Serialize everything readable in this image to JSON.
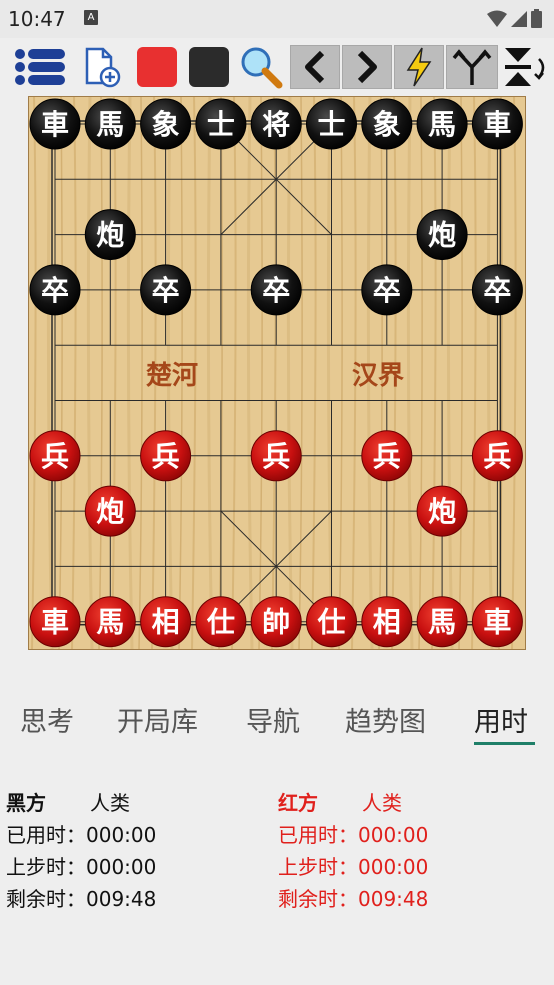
{
  "status_bar": {
    "time": "10:47",
    "indicator": "A"
  },
  "toolbar": {
    "buttons": [
      {
        "name": "menu-icon"
      },
      {
        "name": "new-game-icon"
      },
      {
        "name": "red-swatch-icon",
        "color": "#e83030"
      },
      {
        "name": "black-swatch-icon",
        "color": "#2b2b2b"
      },
      {
        "name": "search-icon"
      },
      {
        "name": "back-icon"
      },
      {
        "name": "forward-icon"
      },
      {
        "name": "lightning-icon"
      },
      {
        "name": "branch-icon"
      },
      {
        "name": "flip-icon"
      }
    ]
  },
  "board": {
    "river_left": "楚河",
    "river_right": "汉界",
    "black_pieces": [
      {
        "ch": "車",
        "file": 0,
        "rank": 0
      },
      {
        "ch": "馬",
        "file": 1,
        "rank": 0
      },
      {
        "ch": "象",
        "file": 2,
        "rank": 0
      },
      {
        "ch": "士",
        "file": 3,
        "rank": 0
      },
      {
        "ch": "将",
        "file": 4,
        "rank": 0
      },
      {
        "ch": "士",
        "file": 5,
        "rank": 0
      },
      {
        "ch": "象",
        "file": 6,
        "rank": 0
      },
      {
        "ch": "馬",
        "file": 7,
        "rank": 0
      },
      {
        "ch": "車",
        "file": 8,
        "rank": 0
      },
      {
        "ch": "炮",
        "file": 1,
        "rank": 2
      },
      {
        "ch": "炮",
        "file": 7,
        "rank": 2
      },
      {
        "ch": "卒",
        "file": 0,
        "rank": 3
      },
      {
        "ch": "卒",
        "file": 2,
        "rank": 3
      },
      {
        "ch": "卒",
        "file": 4,
        "rank": 3
      },
      {
        "ch": "卒",
        "file": 6,
        "rank": 3
      },
      {
        "ch": "卒",
        "file": 8,
        "rank": 3
      }
    ],
    "red_pieces": [
      {
        "ch": "兵",
        "file": 0,
        "rank": 6
      },
      {
        "ch": "兵",
        "file": 2,
        "rank": 6
      },
      {
        "ch": "兵",
        "file": 4,
        "rank": 6
      },
      {
        "ch": "兵",
        "file": 6,
        "rank": 6
      },
      {
        "ch": "兵",
        "file": 8,
        "rank": 6
      },
      {
        "ch": "炮",
        "file": 1,
        "rank": 7
      },
      {
        "ch": "炮",
        "file": 7,
        "rank": 7
      },
      {
        "ch": "車",
        "file": 0,
        "rank": 9
      },
      {
        "ch": "馬",
        "file": 1,
        "rank": 9
      },
      {
        "ch": "相",
        "file": 2,
        "rank": 9
      },
      {
        "ch": "仕",
        "file": 3,
        "rank": 9
      },
      {
        "ch": "帥",
        "file": 4,
        "rank": 9
      },
      {
        "ch": "仕",
        "file": 5,
        "rank": 9
      },
      {
        "ch": "相",
        "file": 6,
        "rank": 9
      },
      {
        "ch": "馬",
        "file": 7,
        "rank": 9
      },
      {
        "ch": "車",
        "file": 8,
        "rank": 9
      }
    ]
  },
  "tabs": [
    {
      "label": "思考"
    },
    {
      "label": "开局库"
    },
    {
      "label": "导航"
    },
    {
      "label": "趋势图"
    },
    {
      "label": "用时",
      "active": true
    }
  ],
  "timers": {
    "black": {
      "side": "黑方",
      "player": "人类",
      "used_label": "已用时：",
      "used": "000:00",
      "last_label": "上步时：",
      "last": "000:00",
      "remain_label": "剩余时：",
      "remain": "009:48"
    },
    "red": {
      "side": "红方",
      "player": "人类",
      "used_label": "已用时：",
      "used": "000:00",
      "last_label": "上步时：",
      "last": "000:00",
      "remain_label": "剩余时：",
      "remain": "009:48"
    }
  },
  "colors": {
    "red_text": "#e0201c",
    "tab_accent": "#1f7f68",
    "board": "#e8cc98"
  }
}
